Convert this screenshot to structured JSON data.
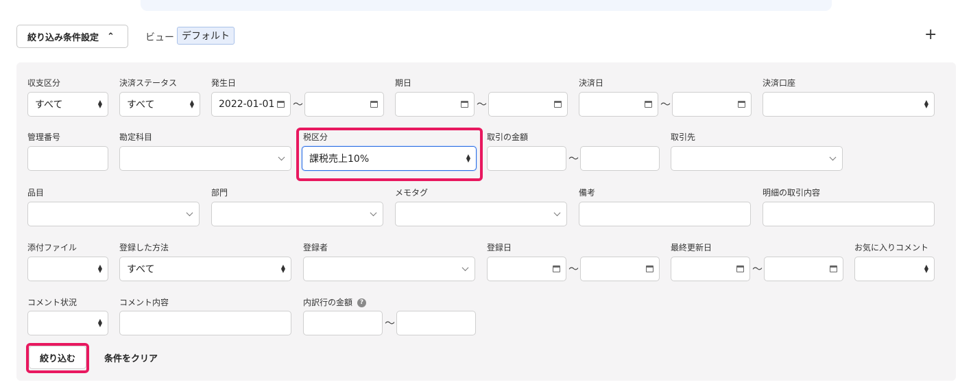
{
  "filter_toggle": {
    "label": "絞り込み条件設定",
    "chevron": "chevron-up-icon"
  },
  "view": {
    "label": "ビュー",
    "current": "デフォルト"
  },
  "add_icon": {
    "glyph": "+"
  },
  "range_sep": "〜",
  "fields": {
    "income_type": {
      "label": "収支区分",
      "value": "すべて"
    },
    "settlement_status": {
      "label": "決済ステータス",
      "value": "すべて"
    },
    "issue_date": {
      "label": "発生日",
      "from": "2022-01-01",
      "to": ""
    },
    "due_date": {
      "label": "期日",
      "from": "",
      "to": ""
    },
    "settlement_date": {
      "label": "決済日",
      "from": "",
      "to": ""
    },
    "settlement_account": {
      "label": "決済口座",
      "value": ""
    },
    "management_no": {
      "label": "管理番号",
      "value": ""
    },
    "account_item": {
      "label": "勘定科目",
      "value": ""
    },
    "tax_category": {
      "label": "税区分",
      "value": "課税売上10%"
    },
    "transaction_amount": {
      "label": "取引の金額",
      "from": "",
      "to": ""
    },
    "partner": {
      "label": "取引先",
      "value": ""
    },
    "item": {
      "label": "品目",
      "value": ""
    },
    "department": {
      "label": "部門",
      "value": ""
    },
    "memo_tag": {
      "label": "メモタグ",
      "value": ""
    },
    "remarks": {
      "label": "備考",
      "value": ""
    },
    "detail_description": {
      "label": "明細の取引内容",
      "value": ""
    },
    "attachment": {
      "label": "添付ファイル",
      "value": ""
    },
    "registration_method": {
      "label": "登録した方法",
      "value": "すべて"
    },
    "registrant": {
      "label": "登録者",
      "value": ""
    },
    "registration_date": {
      "label": "登録日",
      "from": "",
      "to": ""
    },
    "last_updated": {
      "label": "最終更新日",
      "from": "",
      "to": ""
    },
    "favorite_comment": {
      "label": "お気に入りコメント",
      "value": ""
    },
    "comment_status": {
      "label": "コメント状況",
      "value": ""
    },
    "comment_content": {
      "label": "コメント内容",
      "value": ""
    },
    "breakdown_amount": {
      "label": "内訳行の金額",
      "from": "",
      "to": "",
      "help": "?"
    }
  },
  "actions": {
    "apply": "絞り込む",
    "clear": "条件をクリア"
  },
  "colors": {
    "highlight": "#e8185f",
    "focus": "#2f6fe0",
    "panel_bg": "#f5f4f5"
  }
}
